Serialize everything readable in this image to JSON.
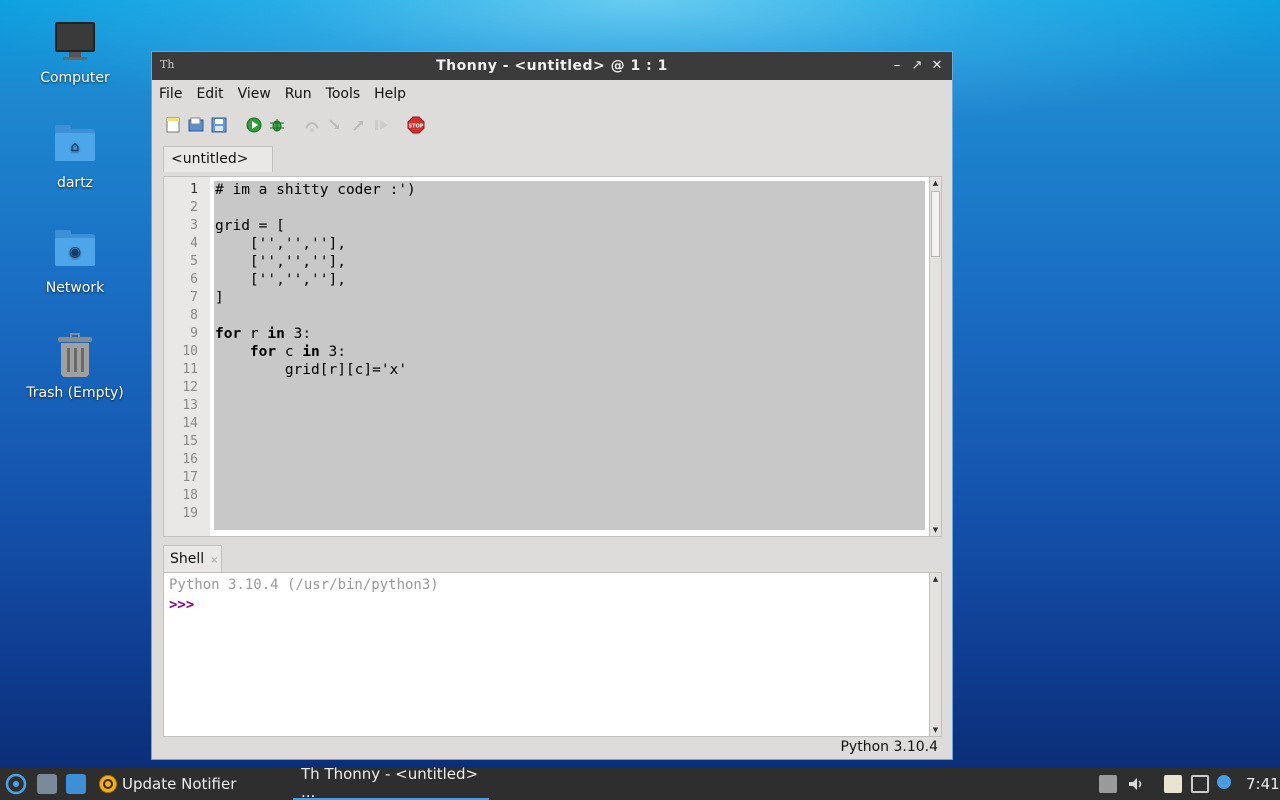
{
  "desktop": {
    "icons": [
      {
        "label": "Computer"
      },
      {
        "label": "dartz"
      },
      {
        "label": "Network"
      },
      {
        "label": "Trash (Empty)"
      }
    ]
  },
  "window": {
    "title": "Thonny  -  <untitled>  @  1 : 1",
    "app_icon": "Th",
    "controls": {
      "minimize": "–",
      "maximize": "↗",
      "close": "✕"
    }
  },
  "menubar": {
    "items": [
      "File",
      "Edit",
      "View",
      "Run",
      "Tools",
      "Help"
    ]
  },
  "toolbar": {
    "buttons": [
      "new-file-icon",
      "open-file-icon",
      "save-file-icon",
      "run-icon",
      "debug-icon",
      "step-over-icon",
      "step-into-icon",
      "step-out-icon",
      "resume-icon",
      "stop-icon"
    ],
    "stop_label": "STOP"
  },
  "editor": {
    "tab_label": "<untitled> *",
    "tab_close": "×",
    "line_numbers": [
      "1",
      "2",
      "3",
      "4",
      "5",
      "6",
      "7",
      "8",
      "9",
      "10",
      "11",
      "12",
      "13",
      "14",
      "15",
      "16",
      "17",
      "18",
      "19"
    ],
    "lines": [
      "# im a shitty coder :')",
      "",
      "grid = [",
      "    ['','',''],",
      "    ['','',''],",
      "    ['','',''],",
      "]",
      "",
      "for r in 3:",
      "    for c in 3:",
      "        grid[r][c]='x'"
    ]
  },
  "shell": {
    "tab_label": "Shell",
    "tab_close": "×",
    "info": "Python 3.10.4 (/usr/bin/python3)",
    "prompt": ">>>"
  },
  "status": {
    "python_version": "Python 3.10.4"
  },
  "taskbar": {
    "update_notifier": "Update Notifier",
    "active_window": "Th  Thonny  -  <untitled>  ...",
    "clock": "7:41"
  },
  "colors": {
    "titlebar_bg": "#3b3b3b",
    "selection": "#c8c8c8",
    "prompt": "#8b008b",
    "accent": "#4a9be0"
  }
}
